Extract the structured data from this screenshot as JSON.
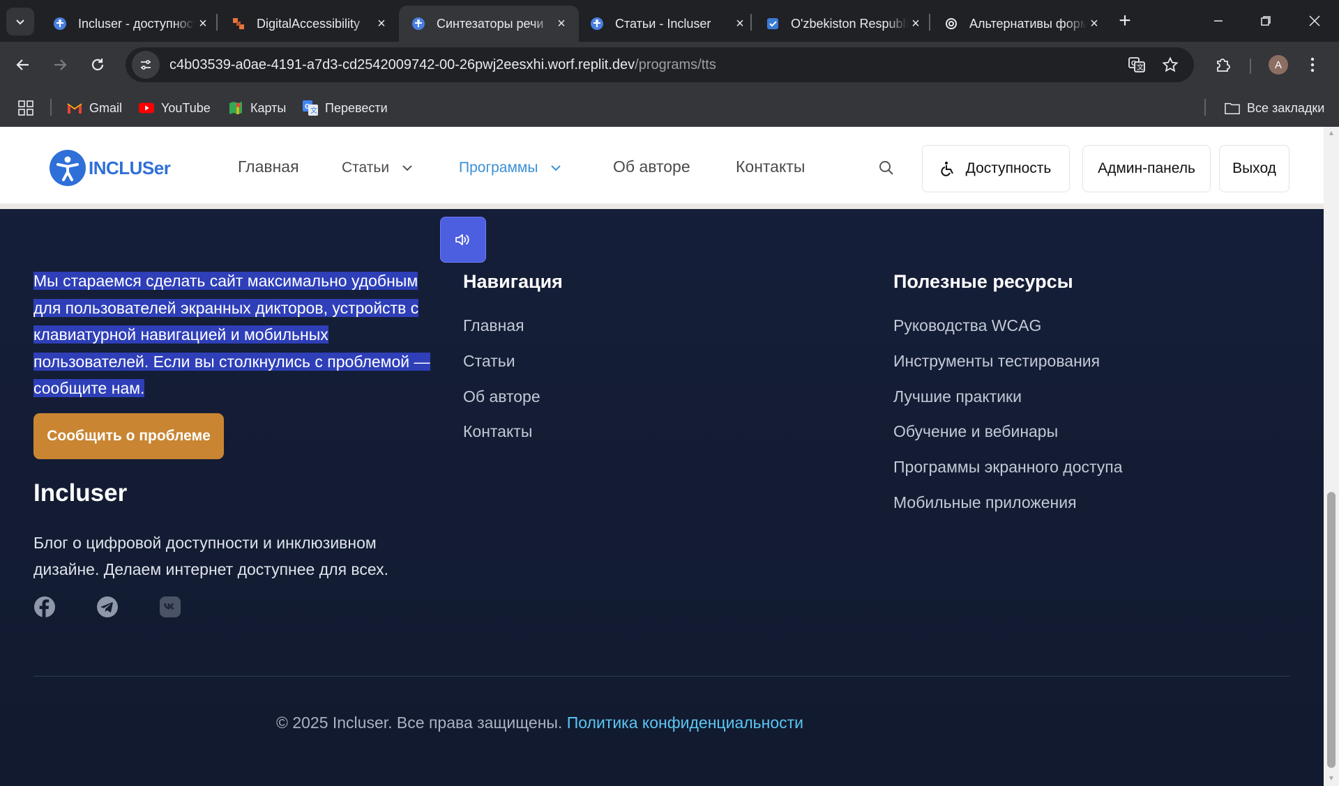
{
  "browser": {
    "tabs": [
      {
        "title": "Incluser - доступность",
        "active": false
      },
      {
        "title": "DigitalAccessibility",
        "active": false
      },
      {
        "title": "Синтезаторы речи",
        "active": true
      },
      {
        "title": "Статьи - Incluser",
        "active": false
      },
      {
        "title": "O'zbekiston Respublikasi",
        "active": false
      },
      {
        "title": "Альтернативы форм",
        "active": false
      }
    ],
    "url_host": "c4b03539-a0ae-4191-a7d3-cd2542009742-00-26pwj2eesxhi.worf.replit.dev",
    "url_path": "/programs/tts",
    "avatar_letter": "A",
    "bookmarks": [
      "Gmail",
      "YouTube",
      "Карты",
      "Перевести"
    ],
    "all_bookmarks": "Все закладки"
  },
  "header": {
    "logo_text": "INCLUSer",
    "nav": {
      "home": "Главная",
      "articles": "Статьи",
      "programs": "Программы",
      "about": "Об авторе",
      "contacts": "Контакты"
    },
    "accessibility_btn": "Доступность",
    "admin_btn": "Админ-панель",
    "logout_btn": "Выход"
  },
  "footer": {
    "selected_text": "Мы стараемся сделать сайт максимально удобным для пользователей экранных дикторов, устройств с клавиатурной навигацией и мобильных пользователей. Если вы столкнулись с проблемой — сообщите нам.",
    "report_btn": "Сообщить о проблеме",
    "brand_title": "Incluser",
    "brand_desc": "Блог о цифровой доступности и инклюзивном дизайне. Делаем интернет доступнее для всех.",
    "nav_title": "Навигация",
    "nav_links": [
      "Главная",
      "Статьи",
      "Об авторе",
      "Контакты"
    ],
    "resources_title": "Полезные ресурсы",
    "resources_links": [
      "Руководства WCAG",
      "Инструменты тестирования",
      "Лучшие практики",
      "Обучение и вебинары",
      "Программы экранного доступа",
      "Мобильные приложения"
    ],
    "copyright": "© 2025 Incluser. Все права защищены.",
    "privacy_link": "Политика конфиденциальности"
  },
  "colors": {
    "footer_bg": "#131b31",
    "accent_orange": "#c98532",
    "link_cyan": "#5cc6f2",
    "selection": "#2e3fb8",
    "tts_button": "#4c5fe0"
  }
}
